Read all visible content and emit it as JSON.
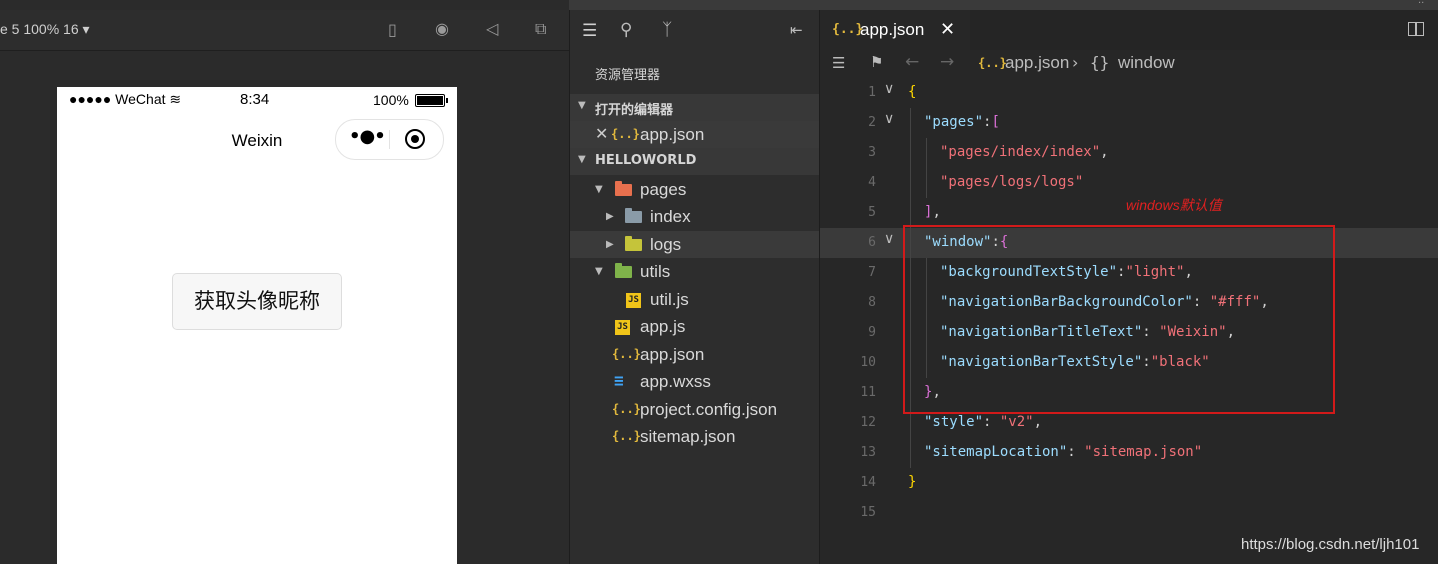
{
  "simulator": {
    "device_label": "e 5 100% 16 ▾",
    "status": {
      "carrier": "●●●●● WeChat",
      "time": "8:34",
      "battery": "100%"
    },
    "nav_title": "Weixin",
    "button_label": "获取头像昵称"
  },
  "explorer": {
    "title": "资源管理器",
    "open_editors_label": "打开的编辑器",
    "open_file": "app.json",
    "project_label": "HELLOWORLD",
    "tree": [
      {
        "name": "pages",
        "type": "folder",
        "color": "#e8704e"
      },
      {
        "name": "index",
        "type": "folder",
        "color": "#8a9ba8"
      },
      {
        "name": "logs",
        "type": "folder",
        "color": "#c5c43a"
      },
      {
        "name": "utils",
        "type": "folder",
        "color": "#7fb34a"
      },
      {
        "name": "util.js",
        "type": "js"
      },
      {
        "name": "app.js",
        "type": "js"
      },
      {
        "name": "app.json",
        "type": "json"
      },
      {
        "name": "app.wxss",
        "type": "css"
      },
      {
        "name": "project.config.json",
        "type": "json"
      },
      {
        "name": "sitemap.json",
        "type": "json"
      }
    ]
  },
  "editor": {
    "tab_label": "app.json",
    "tab_icon": "{..}",
    "breadcrumb": {
      "file_icon": "{..}",
      "file": "app.json",
      "separator": "›",
      "obj_icon": "{}",
      "node": "window"
    },
    "lines": [
      {
        "n": "1",
        "fold": "∨",
        "tokens": [
          [
            "b1",
            "{"
          ]
        ]
      },
      {
        "n": "2",
        "fold": "∨",
        "tokens": [
          [
            "k",
            "\"pages\""
          ],
          [
            "p",
            ":"
          ],
          [
            "b2",
            "["
          ]
        ]
      },
      {
        "n": "3",
        "fold": "",
        "tokens": [
          [
            "s",
            "\"pages/index/index\""
          ],
          [
            "p",
            ","
          ]
        ]
      },
      {
        "n": "4",
        "fold": "",
        "tokens": [
          [
            "s",
            "\"pages/logs/logs\""
          ]
        ]
      },
      {
        "n": "5",
        "fold": "",
        "tokens": [
          [
            "b2",
            "]"
          ],
          [
            "p",
            ","
          ]
        ]
      },
      {
        "n": "6",
        "fold": "∨",
        "tokens": [
          [
            "k",
            "\"window\""
          ],
          [
            "p",
            ":"
          ],
          [
            "b2",
            "{"
          ]
        ]
      },
      {
        "n": "7",
        "fold": "",
        "tokens": [
          [
            "k",
            "\"backgroundTextStyle\""
          ],
          [
            "p",
            ":"
          ],
          [
            "s",
            "\"light\""
          ],
          [
            "p",
            ","
          ]
        ]
      },
      {
        "n": "8",
        "fold": "",
        "tokens": [
          [
            "k",
            "\"navigationBarBackgroundColor\""
          ],
          [
            "p",
            ": "
          ],
          [
            "s",
            "\"#fff\""
          ],
          [
            "p",
            ","
          ]
        ]
      },
      {
        "n": "9",
        "fold": "",
        "tokens": [
          [
            "k",
            "\"navigationBarTitleText\""
          ],
          [
            "p",
            ": "
          ],
          [
            "s",
            "\"Weixin\""
          ],
          [
            "p",
            ","
          ]
        ]
      },
      {
        "n": "10",
        "fold": "",
        "tokens": [
          [
            "k",
            "\"navigationBarTextStyle\""
          ],
          [
            "p",
            ":"
          ],
          [
            "s",
            "\"black\""
          ]
        ]
      },
      {
        "n": "11",
        "fold": "",
        "tokens": [
          [
            "b2",
            "}"
          ],
          [
            "p",
            ","
          ]
        ]
      },
      {
        "n": "12",
        "fold": "",
        "tokens": [
          [
            "k",
            "\"style\""
          ],
          [
            "p",
            ": "
          ],
          [
            "s",
            "\"v2\""
          ],
          [
            "p",
            ","
          ]
        ]
      },
      {
        "n": "13",
        "fold": "",
        "tokens": [
          [
            "k",
            "\"sitemapLocation\""
          ],
          [
            "p",
            ": "
          ],
          [
            "s",
            "\"sitemap.json\""
          ]
        ]
      },
      {
        "n": "14",
        "fold": "",
        "tokens": [
          [
            "b1",
            "}"
          ]
        ]
      },
      {
        "n": "15",
        "fold": "",
        "tokens": []
      }
    ]
  },
  "annotation": {
    "label": "windows默认值",
    "color": "#d21a1a"
  },
  "watermark": "https://blog.csdn.net/ljh101",
  "colors": {
    "key": "#9cdcfe",
    "string": "#f07178",
    "brace": "#ffd700",
    "bracket": "#da70d6"
  }
}
